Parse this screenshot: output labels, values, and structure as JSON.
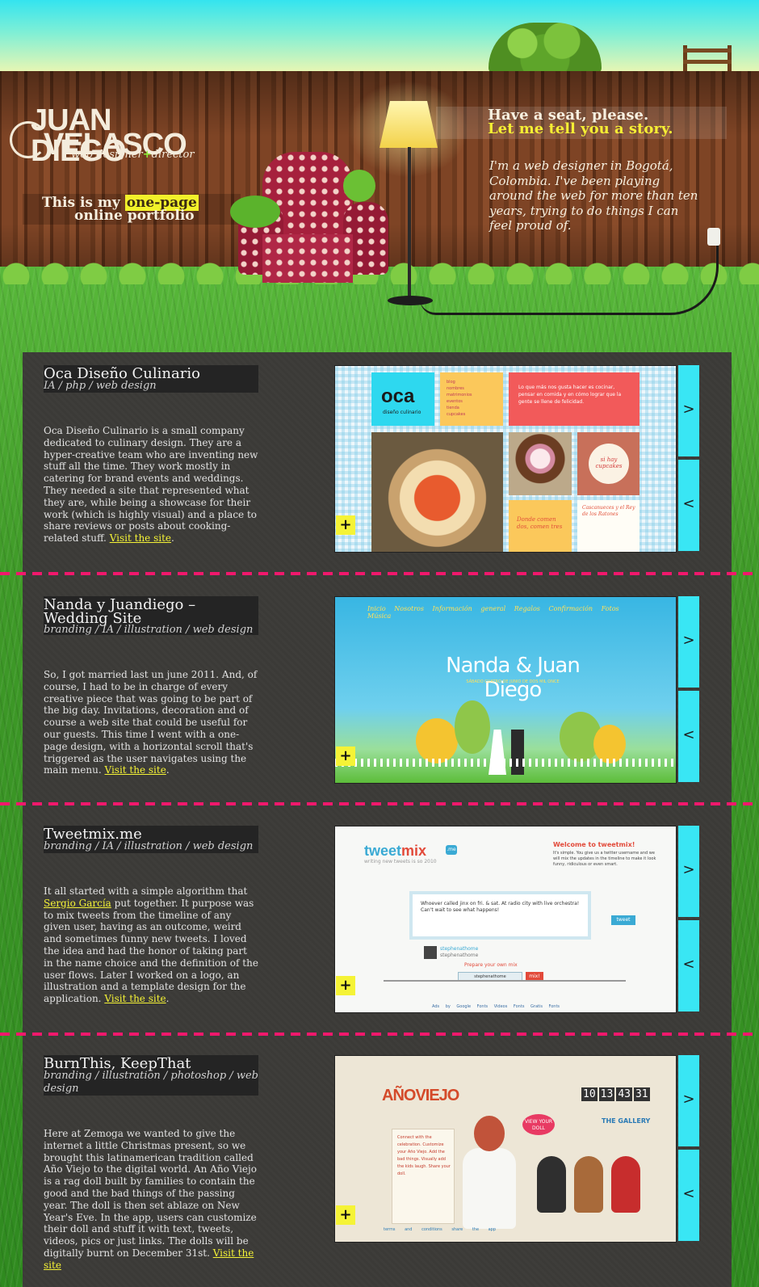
{
  "header": {
    "logo_line1": "JUAN DIEGO",
    "logo_line2": "VELASCO",
    "logo_tag_a": "web designer",
    "logo_tag_plus": "+",
    "logo_tag_b": "director",
    "intro_a": "This is my",
    "intro_hl": "one-page",
    "intro_b": "online portfolio",
    "seat_line1": "Have a seat, please.",
    "seat_line2": "Let me tell you a story.",
    "bio": "I'm a web designer in Bogotá, Colombia. I've been playing around the web for more than ten years, trying to do things I can feel proud of."
  },
  "colors": {
    "accent_yellow": "#f5f336",
    "nav_cyan": "#39e6f4",
    "divider_pink": "#f0186c",
    "panel": "#3b3a37"
  },
  "projects": [
    {
      "title": "Oca Diseño Culinario",
      "tags": "IA / php / web design",
      "desc": "Oca Diseño Culinario is a small company dedicated to culinary design. They are a hyper-creative team who are inventing new stuff all the time. They work mostly in catering for brand events and weddings. They needed a site that represented what they are, while being a showcase for their work (which is highly visual) and a place to share reviews or posts about cooking-related stuff.",
      "link": "Visit the site",
      "after_link": ".",
      "plus": "+",
      "next": ">",
      "prev": "<",
      "shot": {
        "logo": "oca",
        "logo_sub": "diseño culinario",
        "menu": [
          "blog",
          "nombres",
          "matrimonios",
          "eventos",
          "tienda",
          "cupcakes"
        ],
        "quote": "Lo que más nos gusta hacer es cocinar, pensar en comida y en cómo lograr que la gente se llene de felicidad.",
        "cupcakes_label": "si hay cupcakes",
        "card_quote": "Donde comen dos, comen tres",
        "card_title": "Cascanueces y el Rey de los Ratones"
      }
    },
    {
      "title": "Nanda y Juandiego – Wedding Site",
      "tags": "branding / IA / illustration / web design",
      "desc": "So, I got married last un june 2011. And, of course, I had to be in charge of every creative piece that was going to be part of the big day. Invitations, decoration and of course a web site that could be useful for our guests. This time I went with a one-page design, with a horizontal scroll that's triggered as the user navigates using the main menu.",
      "link": "Visit the site",
      "after_link": ".",
      "plus": "+",
      "next": ">",
      "prev": "<",
      "shot": {
        "menu": "Inicio Nosotros Información general Regalos Confirmación Fotos Música",
        "title": "Nanda & Juan Diego",
        "subtitle": "SÁBADO CUATRO DE JUNIO DE DOS MIL ONCE"
      }
    },
    {
      "title": "Tweetmix.me",
      "tags": "branding / IA / illustration / web design",
      "desc_before": "It all started with a simple algorithm that",
      "desc_link": "Sergio García",
      "desc": "put together. It purpose was to mix tweets from the timeline of any given user, having as an outcome, weird and sometimes funny new tweets. I loved the idea and had the honor of taking part in the name choice and the definition of the user flows. Later I worked on a logo, an illustration and a template design for the application.",
      "link": "Visit the site",
      "after_link": ".",
      "plus": "+",
      "next": ">",
      "prev": "<",
      "shot": {
        "logo_a": "tweet",
        "logo_b": "mix",
        "badge": ".me",
        "sub": "writing new tweets is so 2010",
        "welcome": "Welcome to tweetmix!",
        "welcome_text": "It's simple. You give us a twitter username and we will mix the updates in the timeline to make it look funny, ridiculous or even smart.",
        "tweet": "Whoever called jinx on fri. & sat. At radio city with live orchestra! Can't wait to see what happens!",
        "user": "stephenathome",
        "user_sub": "stephenathome",
        "prepare": "Prepare your own mix",
        "input": "stephenathome",
        "mix_btn": "mix!",
        "tweet_btn": "tweet",
        "footer": "Ads by Google Fonts Videos Fonts Gratis Fonts"
      }
    },
    {
      "title": "BurnThis, KeepThat",
      "tags": "branding / illustration / photoshop / web design",
      "desc": "Here at Zemoga we wanted to give the internet a little Christmas present, so we brought this latinamerican tradition called Año Viejo to the digital world. An Año Viejo is a rag doll built by families to contain the good and the bad things of the passing year. The doll is then set ablaze on New Year's Eve. In the app, users can customize their doll and stuff it with text, tweets, videos, pics or just links. The dolls will be digitally burnt on December 31st.",
      "link": "Visit the site",
      "after_link": "",
      "plus": "+",
      "next": ">",
      "prev": "<",
      "shot": {
        "logo": "AÑOVIEJO",
        "list": "Connect with the celebration. Customize your Año Viejo. Add the bad things. Visually add the kids laugh. Share your doll.",
        "bubble": "VIEW YOUR DOLL",
        "counter": [
          "10",
          "13",
          "43",
          "31"
        ],
        "gallery": "THE GALLERY",
        "footer": "terms and conditions  share the app"
      }
    }
  ]
}
